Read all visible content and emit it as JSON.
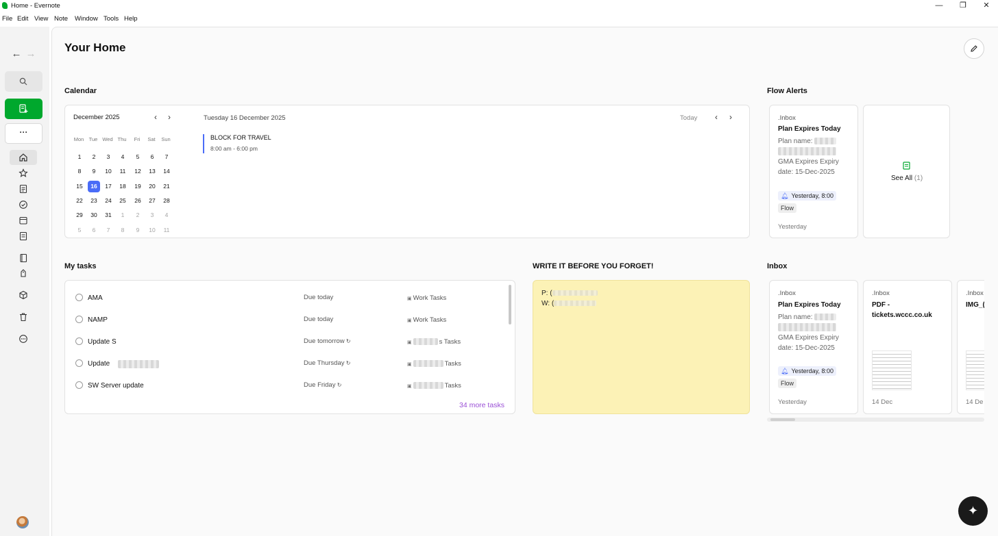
{
  "window": {
    "title": "Home - Evernote",
    "controls": {
      "minimize": "—",
      "restore": "❐",
      "close": "✕"
    }
  },
  "menubar": [
    "File",
    "Edit",
    "View",
    "Note",
    "Window",
    "Tools",
    "Help"
  ],
  "sidebar": {
    "more_label": "···",
    "icons": [
      "home-icon",
      "star-icon",
      "notes-icon",
      "tasks-icon",
      "calendar-icon",
      "notebook-icon",
      "notebooks-icon",
      "tag-icon",
      "spaces-icon",
      "trash-icon",
      "more-icon"
    ]
  },
  "page": {
    "title": "Your Home"
  },
  "calendar": {
    "section_title": "Calendar",
    "month_label": "December 2025",
    "weekdays": [
      "Mon",
      "Tue",
      "Wed",
      "Thu",
      "Fri",
      "Sat",
      "Sun"
    ],
    "weeks": [
      [
        "1",
        "2",
        "3",
        "4",
        "5",
        "6",
        "7"
      ],
      [
        "8",
        "9",
        "10",
        "11",
        "12",
        "13",
        "14"
      ],
      [
        "15",
        "16",
        "17",
        "18",
        "19",
        "20",
        "21"
      ],
      [
        "22",
        "23",
        "24",
        "25",
        "26",
        "27",
        "28"
      ],
      [
        "29",
        "30",
        "31",
        "1",
        "2",
        "3",
        "4"
      ],
      [
        "5",
        "6",
        "7",
        "8",
        "9",
        "10",
        "11"
      ]
    ],
    "selected_day": "16",
    "date_heading": "Tuesday 16 December 2025",
    "today_label": "Today",
    "event": {
      "title": "BLOCK FOR TRAVEL",
      "time": "8:00 am - 6:00 pm"
    }
  },
  "flow_alerts": {
    "section_title": "Flow Alerts",
    "card": {
      "notebook": ".Inbox",
      "title": "Plan Expires Today",
      "plan_label": "Plan name:",
      "expiry_line1": "GMA Expires Expiry",
      "expiry_line2": "date: 15-Dec-2025",
      "reminder": "Yesterday, 8:00",
      "tag": "Flow",
      "date": "Yesterday"
    },
    "see_all_label": "See All",
    "see_all_count": "(1)"
  },
  "tasks": {
    "section_title": "My tasks",
    "items": [
      {
        "name": "AMA",
        "due": "Due today",
        "list": "Work Tasks",
        "recurring": false
      },
      {
        "name": "NAMP",
        "due": "Due today",
        "list": "Work Tasks",
        "recurring": false
      },
      {
        "name": "Update S",
        "due": "Due tomorrow",
        "list": "s Tasks",
        "recurring": true
      },
      {
        "name": "Update",
        "due": "Due Thursday",
        "list": "Tasks",
        "recurring": true
      },
      {
        "name": "SW Server update",
        "due": "Due Friday",
        "list": "Tasks",
        "recurring": true
      }
    ],
    "more_label": "34 more tasks"
  },
  "scratch_pad": {
    "section_title": "WRITE IT BEFORE YOU FORGET!",
    "lines": [
      "P: (",
      "W: ("
    ]
  },
  "inbox": {
    "section_title": "Inbox",
    "cards": [
      {
        "notebook": ".Inbox",
        "title": "Plan Expires Today",
        "plan_label": "Plan name:",
        "expiry_line1": "GMA Expires Expiry",
        "expiry_line2": "date: 15-Dec-2025",
        "reminder": "Yesterday, 8:00",
        "tag": "Flow",
        "date": "Yesterday"
      },
      {
        "notebook": ".Inbox",
        "title_line1": "PDF -",
        "title_line2": "tickets.wccc.co.uk",
        "date": "14 Dec"
      },
      {
        "notebook": ".Inbox",
        "title": "IMG_(",
        "date": "14 De"
      }
    ]
  },
  "colors": {
    "accent_green": "#00a82d",
    "calendar_selected": "#4a6cf7",
    "more_tasks_link": "#9a4fd6",
    "sticky_note": "#fcf2b6"
  },
  "fab": {
    "icon": "sparkle-icon",
    "glyph": "✦"
  }
}
